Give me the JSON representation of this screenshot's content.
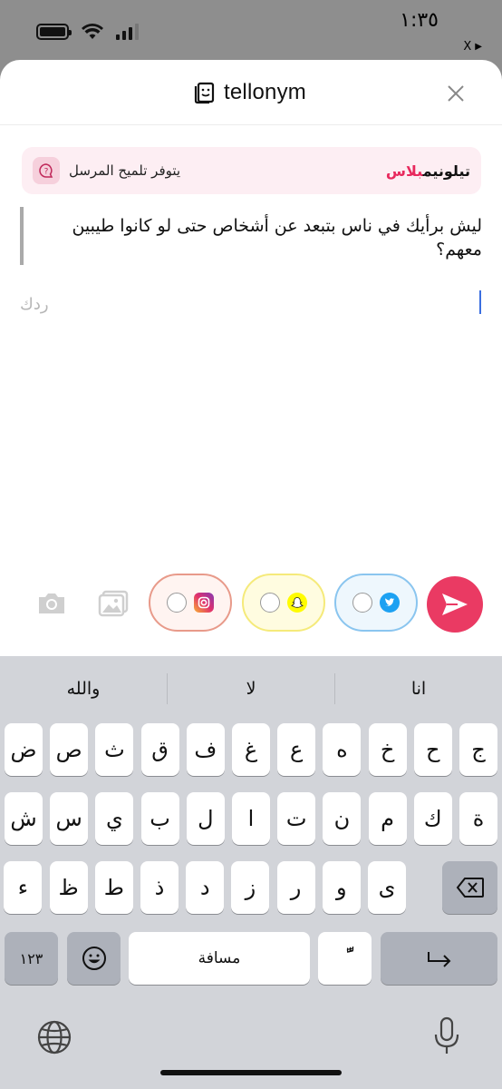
{
  "status": {
    "time": "١:٣٥",
    "back_app_label": "X"
  },
  "header": {
    "brand": "tellonym",
    "close_icon": "close-icon",
    "logo_icon": "tellonym-logo-icon"
  },
  "hint": {
    "brand_main": "تيلونيم",
    "brand_plus": "بلاس",
    "text": "يتوفر تلميح المرسل",
    "icon": "question-bubble-icon",
    "brand_color": "#e8295d"
  },
  "question": {
    "text": "ليش برأيك في ناس بتبعد عن أشخاص حتى لو كانوا طيبين معهم؟"
  },
  "answer": {
    "value": "",
    "placeholder": "ردك"
  },
  "share": {
    "camera_icon": "camera-icon",
    "gallery_icon": "gallery-icon",
    "instagram_icon": "instagram-icon",
    "snapchat_icon": "snapchat-icon",
    "twitter_icon": "twitter-icon",
    "send_icon": "send-icon",
    "send_color": "#ea3a63"
  },
  "keyboard": {
    "suggestions": [
      "انا",
      "لا",
      "والله"
    ],
    "row1": [
      "ج",
      "ح",
      "خ",
      "ه",
      "ع",
      "غ",
      "ف",
      "ق",
      "ث",
      "ص",
      "ض"
    ],
    "row2": [
      "ة",
      "ك",
      "م",
      "ن",
      "ت",
      "ا",
      "ل",
      "ب",
      "ي",
      "س",
      "ش"
    ],
    "row3": [
      "ى",
      "و",
      "ر",
      "ز",
      "د",
      "ذ",
      "ط",
      "ظ",
      "ء"
    ],
    "numbers_label": "١٢٣",
    "space_label": "مسافة",
    "diacritic_label": "ًّ",
    "emoji_icon": "emoji-icon",
    "return_icon": "return-icon",
    "delete_icon": "delete-icon",
    "globe_icon": "globe-icon",
    "mic_icon": "microphone-icon"
  }
}
